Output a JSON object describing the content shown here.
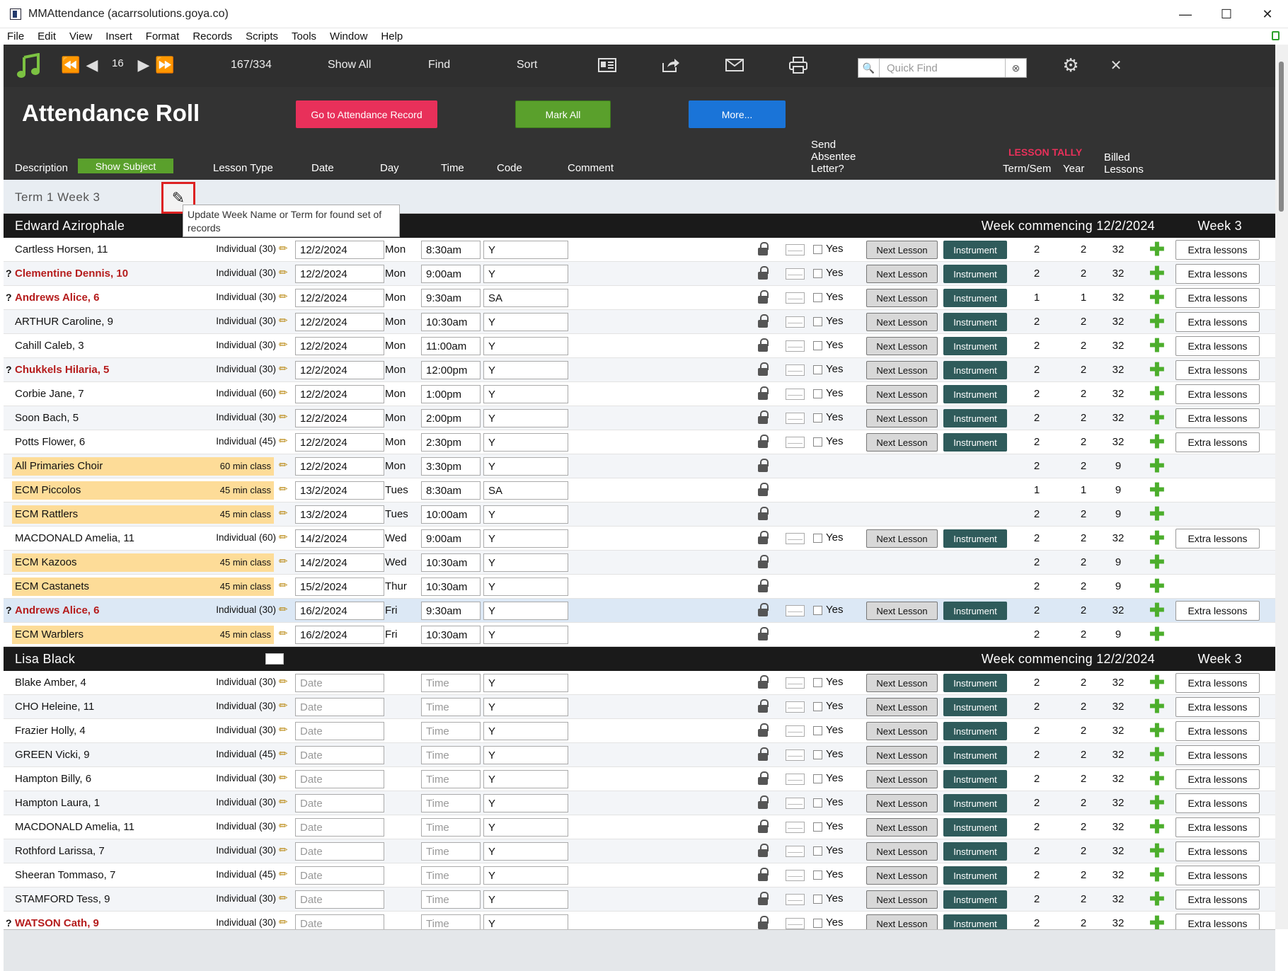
{
  "window": {
    "title": "MMAttendance (acarrsolutions.goya.co)",
    "controls": [
      "—",
      "☐",
      "✕"
    ]
  },
  "menu": [
    "File",
    "Edit",
    "View",
    "Insert",
    "Format",
    "Records",
    "Scripts",
    "Tools",
    "Window",
    "Help"
  ],
  "toolbar": {
    "record_number": "16",
    "record_count": "167/334",
    "show_all": "Show All",
    "find": "Find",
    "sort": "Sort",
    "quick_find_placeholder": "Quick Find"
  },
  "header": {
    "title": "Attendance Roll",
    "btn_attendance": "Go to Attendance Record",
    "btn_mark_all": "Mark All",
    "btn_more": "More...",
    "colors": {
      "attendance": "#e8305a",
      "mark_all": "#5aa02c",
      "more": "#1a74d8"
    }
  },
  "columns": {
    "description": "Description",
    "show_subject": "Show Subject",
    "lesson_type": "Lesson Type",
    "date": "Date",
    "day": "Day",
    "time": "Time",
    "code": "Code",
    "comment": "Comment",
    "send_1": "Send",
    "send_2": "Absentee",
    "send_3": "Letter?",
    "tally": "LESSON TALLY",
    "term_sem": "Term/Sem",
    "year": "Year",
    "billed_1": "Billed",
    "billed_2": "Lessons"
  },
  "term": {
    "name": "Term 1 Week 3",
    "tooltip": "Update Week Name or Term for found set of records"
  },
  "labels": {
    "yes": "Yes",
    "next_lesson": "Next Lesson",
    "instrument": "Instrument",
    "extra": "Extra lessons",
    "date_ph": "Date",
    "time_ph": "Time"
  },
  "groups": [
    {
      "teacher": "Edward Azirophale",
      "week": "Week commencing 12/2/2024",
      "week_no": "Week 3",
      "rows": [
        {
          "name": "Cartless Horsen, 11",
          "lt": "Individual (30)",
          "date": "12/2/2024",
          "day": "Mon",
          "time": "8:30am",
          "code": "Y",
          "t1": "2",
          "t2": "2",
          "t3": "32"
        },
        {
          "q": "?",
          "red": true,
          "name": "Clementine Dennis, 10",
          "lt": "Individual (30)",
          "date": "12/2/2024",
          "day": "Mon",
          "time": "9:00am",
          "code": "Y",
          "t1": "2",
          "t2": "2",
          "t3": "32"
        },
        {
          "q": "?",
          "red": true,
          "name": "Andrews Alice, 6",
          "lt": "Individual (30)",
          "date": "12/2/2024",
          "day": "Mon",
          "time": "9:30am",
          "code": "SA",
          "t1": "1",
          "t2": "1",
          "t3": "32"
        },
        {
          "name": "ARTHUR Caroline, 9",
          "lt": "Individual (30)",
          "date": "12/2/2024",
          "day": "Mon",
          "time": "10:30am",
          "code": "Y",
          "t1": "2",
          "t2": "2",
          "t3": "32"
        },
        {
          "name": "Cahill Caleb, 3",
          "lt": "Individual (30)",
          "date": "12/2/2024",
          "day": "Mon",
          "time": "11:00am",
          "code": "Y",
          "t1": "2",
          "t2": "2",
          "t3": "32"
        },
        {
          "q": "?",
          "red": true,
          "name": "Chukkels Hilaria, 5",
          "lt": "Individual (30)",
          "date": "12/2/2024",
          "day": "Mon",
          "time": "12:00pm",
          "code": "Y",
          "t1": "2",
          "t2": "2",
          "t3": "32"
        },
        {
          "name": "Corbie Jane, 7",
          "lt": "Individual (60)",
          "date": "12/2/2024",
          "day": "Mon",
          "time": "1:00pm",
          "code": "Y",
          "t1": "2",
          "t2": "2",
          "t3": "32"
        },
        {
          "name": "Soon Bach, 5",
          "lt": "Individual (30)",
          "date": "12/2/2024",
          "day": "Mon",
          "time": "2:00pm",
          "code": "Y",
          "t1": "2",
          "t2": "2",
          "t3": "32"
        },
        {
          "name": "Potts Flower, 6",
          "lt": "Individual (45)",
          "date": "12/2/2024",
          "day": "Mon",
          "time": "2:30pm",
          "code": "Y",
          "t1": "2",
          "t2": "2",
          "t3": "32"
        },
        {
          "cls": true,
          "name": "All Primaries Choir",
          "lt": "60 min class",
          "date": "12/2/2024",
          "day": "Mon",
          "time": "3:30pm",
          "code": "Y",
          "t1": "2",
          "t2": "2",
          "t3": "9"
        },
        {
          "cls": true,
          "name": "ECM Piccolos",
          "lt": "45 min class",
          "date": "13/2/2024",
          "day": "Tues",
          "time": "8:30am",
          "code": "SA",
          "t1": "1",
          "t2": "1",
          "t3": "9"
        },
        {
          "cls": true,
          "name": "ECM Rattlers",
          "lt": "45 min class",
          "date": "13/2/2024",
          "day": "Tues",
          "time": "10:00am",
          "code": "Y",
          "t1": "2",
          "t2": "2",
          "t3": "9"
        },
        {
          "name": "MACDONALD Amelia, 11",
          "lt": "Individual (60)",
          "date": "14/2/2024",
          "day": "Wed",
          "time": "9:00am",
          "code": "Y",
          "t1": "2",
          "t2": "2",
          "t3": "32"
        },
        {
          "cls": true,
          "name": "ECM Kazoos",
          "lt": "45 min class",
          "date": "14/2/2024",
          "day": "Wed",
          "time": "10:30am",
          "code": "Y",
          "t1": "2",
          "t2": "2",
          "t3": "9"
        },
        {
          "cls": true,
          "name": "ECM Castanets",
          "lt": "45 min class",
          "date": "15/2/2024",
          "day": "Thur",
          "time": "10:30am",
          "code": "Y",
          "t1": "2",
          "t2": "2",
          "t3": "9"
        },
        {
          "q": "?",
          "red": true,
          "sel": true,
          "name": "Andrews Alice, 6",
          "lt": "Individual (30)",
          "date": "16/2/2024",
          "day": "Fri",
          "time": "9:30am",
          "code": "Y",
          "t1": "2",
          "t2": "2",
          "t3": "32"
        },
        {
          "cls": true,
          "name": "ECM Warblers",
          "lt": "45 min class",
          "date": "16/2/2024",
          "day": "Fri",
          "time": "10:30am",
          "code": "Y",
          "t1": "2",
          "t2": "2",
          "t3": "9"
        }
      ]
    },
    {
      "teacher": "Lisa Black",
      "week": "Week commencing 12/2/2024",
      "week_no": "Week 3",
      "env": true,
      "rows": [
        {
          "name": "Blake Amber, 4",
          "lt": "Individual (30)",
          "code": "Y",
          "t1": "2",
          "t2": "2",
          "t3": "32"
        },
        {
          "name": "CHO Heleine, 11",
          "lt": "Individual (30)",
          "code": "Y",
          "t1": "2",
          "t2": "2",
          "t3": "32"
        },
        {
          "name": "Frazier Holly, 4",
          "lt": "Individual (30)",
          "code": "Y",
          "t1": "2",
          "t2": "2",
          "t3": "32"
        },
        {
          "name": "GREEN Vicki, 9",
          "lt": "Individual (45)",
          "code": "Y",
          "t1": "2",
          "t2": "2",
          "t3": "32"
        },
        {
          "name": "Hampton Billy, 6",
          "lt": "Individual (30)",
          "code": "Y",
          "t1": "2",
          "t2": "2",
          "t3": "32"
        },
        {
          "name": "Hampton Laura, 1",
          "lt": "Individual (30)",
          "code": "Y",
          "t1": "2",
          "t2": "2",
          "t3": "32"
        },
        {
          "name": "MACDONALD Amelia, 11",
          "lt": "Individual (30)",
          "code": "Y",
          "t1": "2",
          "t2": "2",
          "t3": "32"
        },
        {
          "name": "Rothford Larissa, 7",
          "lt": "Individual (30)",
          "code": "Y",
          "t1": "2",
          "t2": "2",
          "t3": "32"
        },
        {
          "name": "Sheeran Tommaso, 7",
          "lt": "Individual (45)",
          "code": "Y",
          "t1": "2",
          "t2": "2",
          "t3": "32"
        },
        {
          "name": "STAMFORD Tess, 9",
          "lt": "Individual (30)",
          "code": "Y",
          "t1": "2",
          "t2": "2",
          "t3": "32"
        },
        {
          "q": "?",
          "red": true,
          "name": "WATSON Cath, 9",
          "lt": "Individual (30)",
          "code": "Y",
          "t1": "2",
          "t2": "2",
          "t3": "32"
        }
      ]
    }
  ]
}
